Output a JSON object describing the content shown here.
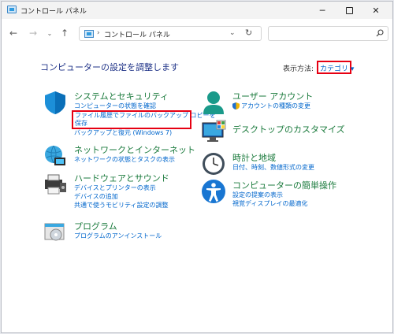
{
  "window": {
    "title": "コントロール パネル",
    "controls": {
      "minimize": "─",
      "close": "✕"
    }
  },
  "nav": {
    "back": "←",
    "forward": "→",
    "recent": "⌄",
    "up": "↑",
    "address_sep": "›",
    "address": "コントロール パネル",
    "address_dropdown": "⌄",
    "refresh": "↻",
    "search_placeholder": ""
  },
  "main": {
    "heading": "コンピューターの設定を調整します",
    "view_by_label": "表示方法:",
    "view_by_value": "カテゴリ ▾",
    "categories_left": [
      {
        "icon": "shield-icon",
        "title": "システムとセキュリティ",
        "links": [
          "コンピューターの状態を確認",
          "ファイル履歴でファイルのバックアップ コピーを",
          "保存",
          "バックアップと復元 (Windows 7)"
        ]
      },
      {
        "icon": "network-icon",
        "title": "ネットワークとインターネット",
        "links": [
          "ネットワークの状態とタスクの表示"
        ]
      },
      {
        "icon": "printer-icon",
        "title": "ハードウェアとサウンド",
        "links": [
          "デバイスとプリンターの表示",
          "デバイスの追加",
          "共通で使うモビリティ設定の調整"
        ]
      },
      {
        "icon": "programs-icon",
        "title": "プログラム",
        "links": [
          "プログラムのアンインストール"
        ]
      }
    ],
    "categories_right": [
      {
        "icon": "user-icon",
        "title": "ユーザー アカウント",
        "links": [
          "アカウントの種類の変更"
        ]
      },
      {
        "icon": "desktop-icon",
        "title": "デスクトップのカスタマイズ",
        "links": []
      },
      {
        "icon": "clock-icon",
        "title": "時計と地域",
        "links": [
          "日付、時刻、数値形式の変更"
        ]
      },
      {
        "icon": "accessibility-icon",
        "title": "コンピューターの簡単操作",
        "links": [
          "設定の提案の表示",
          "視覚ディスプレイの最適化"
        ]
      }
    ]
  },
  "colors": {
    "accent_red": "#e60012",
    "link_blue": "#0066cc",
    "category_green": "#1a7a3c",
    "heading_blue": "#1e3287"
  }
}
